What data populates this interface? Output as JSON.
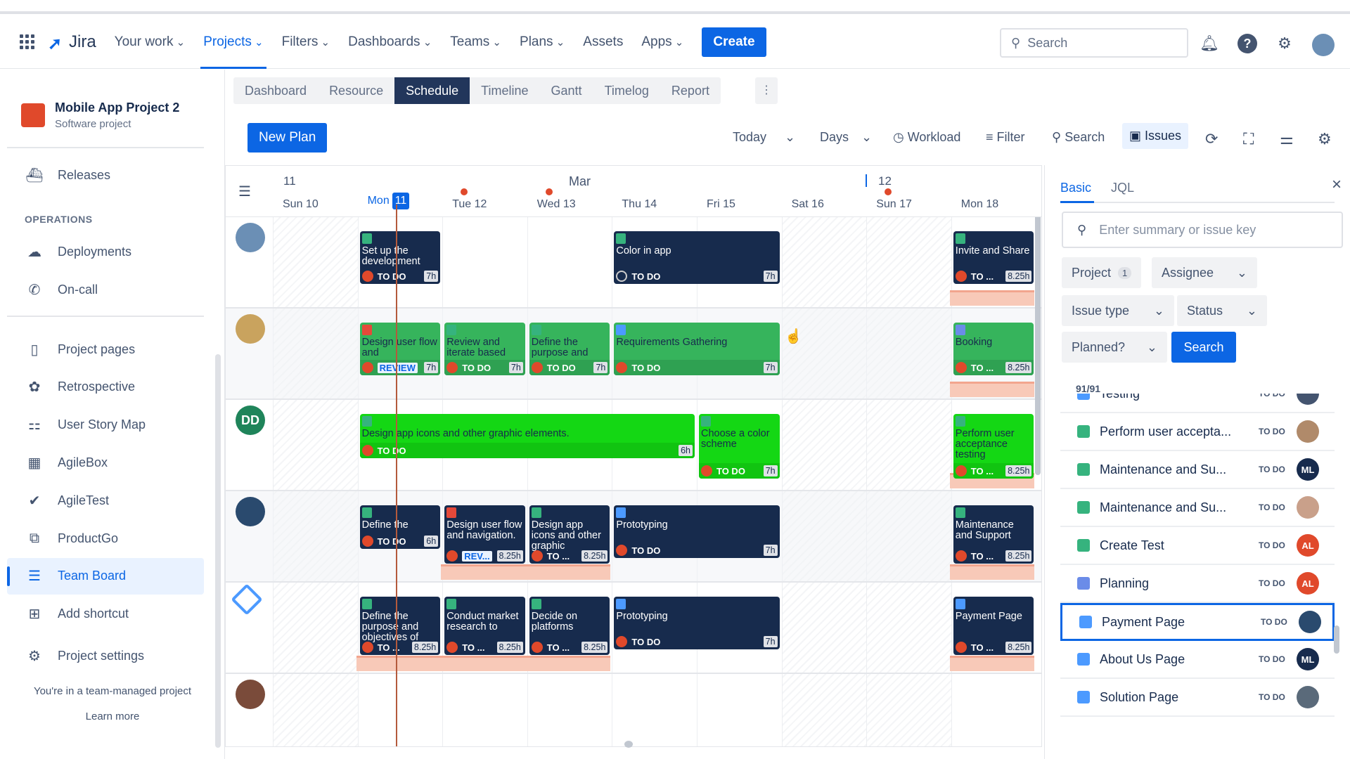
{
  "nav": {
    "app": "Jira",
    "items": [
      "Your work",
      "Projects",
      "Filters",
      "Dashboards",
      "Teams",
      "Plans",
      "Assets",
      "Apps"
    ],
    "active": "Projects",
    "chevron_items": [
      "Your work",
      "Projects",
      "Filters",
      "Dashboards",
      "Teams",
      "Plans",
      "Apps"
    ],
    "create": "Create",
    "search_placeholder": "Search"
  },
  "sidebar": {
    "project_name": "Mobile App Project 2",
    "project_type": "Software project",
    "releases": "Releases",
    "section": "OPERATIONS",
    "ops": [
      "Deployments",
      "On-call"
    ],
    "items": [
      "Project pages",
      "Retrospective",
      "User Story Map",
      "AgileBox",
      "AgileTest",
      "ProductGo",
      "Team Board",
      "Add shortcut",
      "Project settings"
    ],
    "active": "Team Board",
    "footer": "You're in a team-managed project",
    "learn_more": "Learn more"
  },
  "tabs": [
    "Dashboard",
    "Resource",
    "Schedule",
    "Timeline",
    "Gantt",
    "Timelog",
    "Report"
  ],
  "active_tab": "Schedule",
  "toolbar": {
    "new_plan": "New Plan",
    "today": "Today",
    "days": "Days",
    "workload": "Workload",
    "filter": "Filter",
    "search": "Search",
    "issues": "Issues"
  },
  "timeline": {
    "week_left": "11",
    "month": "Mar",
    "week_right": "12",
    "days": [
      "Sun 10",
      "Mon",
      "Tue 12",
      "Wed 13",
      "Thu 14",
      "Fri 15",
      "Sat 16",
      "Sun 17",
      "Mon 18"
    ],
    "today_num": "11",
    "weekend": [
      "Sun 10",
      "Sat 16",
      "Sun 17"
    ],
    "holidays": [
      "Tue 12",
      "Wed 13",
      "Sun 17"
    ]
  },
  "colors": {
    "dark": "#172b4d",
    "green": "#36b45c",
    "lime": "#14d714",
    "accent": "#0c66e4",
    "overbooked": "#f8c9b8"
  },
  "rows": [
    {
      "avatar": "",
      "avatar_color": "#6b8fb5",
      "cards": [
        {
          "title": "Set up the development",
          "type": "story",
          "status": "TO DO",
          "hours": "7h",
          "start": 1,
          "span": 1,
          "style": "dark"
        },
        {
          "title": "Color in app",
          "type": "story",
          "status": "TO DO",
          "status_icon": "open",
          "hours": "7h",
          "start": 4,
          "span": 2,
          "style": "dark"
        },
        {
          "title": "Invite and Share",
          "type": "story",
          "status": "TO ...",
          "hours": "8.25h",
          "start": 8,
          "span": 1,
          "style": "dark",
          "over": true
        }
      ]
    },
    {
      "avatar": "",
      "avatar_color": "#c9a35e",
      "cards": [
        {
          "title": "Design user flow and",
          "type": "bug",
          "status": "REVIEW",
          "hours": "7h",
          "start": 1,
          "span": 1,
          "style": "green"
        },
        {
          "title": "Review and iterate based",
          "type": "story",
          "status": "TO DO",
          "hours": "7h",
          "start": 2,
          "span": 1,
          "style": "green"
        },
        {
          "title": "Define the purpose and",
          "type": "story",
          "status": "TO DO",
          "hours": "7h",
          "start": 3,
          "span": 1,
          "style": "green"
        },
        {
          "title": "Requirements Gathering",
          "type": "task",
          "status": "TO DO",
          "hours": "7h",
          "start": 4,
          "span": 2,
          "style": "green"
        },
        {
          "title": "Booking",
          "type": "epic",
          "status": "TO ...",
          "hours": "8.25h",
          "start": 8,
          "span": 1,
          "style": "green",
          "over": true
        }
      ]
    },
    {
      "avatar": "DD",
      "avatar_color": "#1f845a",
      "cards": [
        {
          "title": "Design app icons and other graphic elements.",
          "type": "story",
          "status": "TO DO",
          "hours": "6h",
          "start": 1,
          "span": 4,
          "style": "lime",
          "short": true
        },
        {
          "title": "Choose a color scheme",
          "type": "story",
          "status": "TO DO",
          "hours": "7h",
          "start": 5,
          "span": 1,
          "style": "lime",
          "tall": true
        },
        {
          "title": "Perform user acceptance testing",
          "type": "story",
          "status": "TO ...",
          "hours": "8.25h",
          "start": 8,
          "span": 1,
          "style": "lime",
          "tall": true,
          "over": true
        }
      ]
    },
    {
      "avatar": "",
      "avatar_color": "#2a4a6e",
      "cards": [
        {
          "title": "Define the",
          "type": "story",
          "status": "TO DO",
          "hours": "6h",
          "start": 1,
          "span": 1,
          "style": "dark",
          "short": true
        },
        {
          "title": "Design user flow and navigation.",
          "type": "bug",
          "status": "REV...",
          "hours": "8.25h",
          "start": 2,
          "span": 1,
          "style": "dark",
          "tall": true,
          "over": true
        },
        {
          "title": "Design app icons and other graphic",
          "type": "story",
          "status": "TO ...",
          "hours": "8.25h",
          "start": 3,
          "span": 1,
          "style": "dark",
          "tall": true,
          "over": true
        },
        {
          "title": "Prototyping",
          "type": "task",
          "status": "TO DO",
          "hours": "7h",
          "start": 4,
          "span": 2,
          "style": "dark"
        },
        {
          "title": "Maintenance and Support",
          "type": "story",
          "status": "TO ...",
          "hours": "8.25h",
          "start": 8,
          "span": 1,
          "style": "dark",
          "tall": true,
          "over": true
        }
      ]
    },
    {
      "avatar": "",
      "avatar_color": "#ffffff",
      "cards": [
        {
          "title": "Define the purpose and objectives of",
          "type": "story",
          "status": "TO ...",
          "hours": "8.25h",
          "start": 1,
          "span": 1,
          "style": "dark",
          "tall": true,
          "over": true
        },
        {
          "title": "Conduct market research to",
          "type": "story",
          "status": "TO ...",
          "hours": "8.25h",
          "start": 2,
          "span": 1,
          "style": "dark",
          "tall": true,
          "over": true
        },
        {
          "title": "Decide on platforms",
          "type": "story",
          "status": "TO ...",
          "hours": "8.25h",
          "start": 3,
          "span": 1,
          "style": "dark",
          "tall": true,
          "over": true
        },
        {
          "title": "Prototyping",
          "type": "task",
          "status": "TO DO",
          "hours": "7h",
          "start": 4,
          "span": 2,
          "style": "dark"
        },
        {
          "title": "Payment Page",
          "type": "subtask",
          "status": "TO ...",
          "hours": "8.25h",
          "start": 8,
          "span": 1,
          "style": "dark",
          "tall": true,
          "over": true
        }
      ]
    },
    {
      "avatar": "",
      "avatar_color": "#7a4b3a",
      "cards": []
    }
  ],
  "panel": {
    "tabs": [
      "Basic",
      "JQL"
    ],
    "search_placeholder": "Enter summary or issue key",
    "filters": {
      "project": "Project",
      "project_count": "1",
      "assignee": "Assignee",
      "issue_type": "Issue type",
      "status": "Status",
      "planned": "Planned?"
    },
    "search_button": "Search",
    "count": "91/91",
    "issues": [
      {
        "title": "Testing",
        "type": "task",
        "status": "TO DO",
        "assignee": "",
        "avatar_color": "#44546f"
      },
      {
        "title": "Perform user accepta...",
        "type": "story",
        "status": "TO DO",
        "assignee": "",
        "avatar_color": "#b08a6a"
      },
      {
        "title": "Maintenance and Su...",
        "type": "story",
        "status": "TO DO",
        "assignee": "ML",
        "avatar_color": "#172b4d"
      },
      {
        "title": "Maintenance and Su...",
        "type": "story",
        "status": "TO DO",
        "assignee": "",
        "avatar_color": "#c9a08a"
      },
      {
        "title": "Create Test",
        "type": "story",
        "status": "TO DO",
        "assignee": "AL",
        "avatar_color": "#e0492b"
      },
      {
        "title": "Planning",
        "type": "epic",
        "status": "TO DO",
        "assignee": "AL",
        "avatar_color": "#e0492b"
      },
      {
        "title": "Payment Page",
        "type": "subtask",
        "status": "TO DO",
        "assignee": "",
        "avatar_color": "#2a4a6e",
        "selected": true
      },
      {
        "title": "About Us Page",
        "type": "subtask",
        "status": "TO DO",
        "assignee": "ML",
        "avatar_color": "#172b4d"
      },
      {
        "title": "Solution Page",
        "type": "subtask",
        "status": "TO DO",
        "assignee": "",
        "avatar_color": "#5a6a7a"
      }
    ]
  }
}
